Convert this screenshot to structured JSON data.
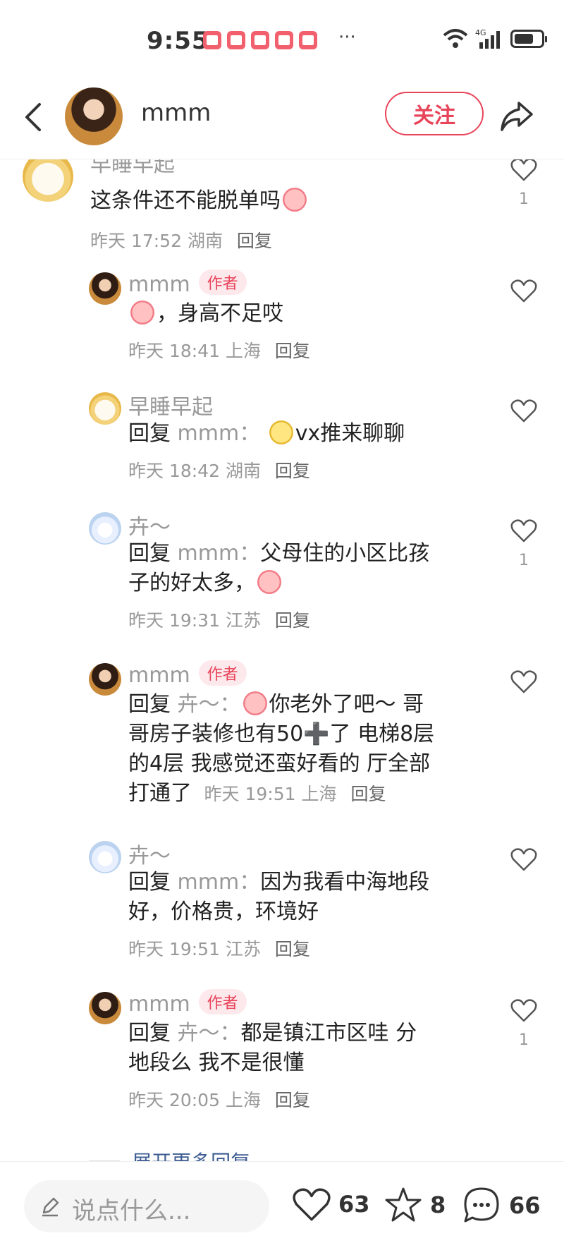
{
  "status_bar": {
    "time": "9:55",
    "network": "4G",
    "more": "···"
  },
  "header": {
    "username": "mmm",
    "follow_label": "关注"
  },
  "comments": [
    {
      "user": "早睡早起",
      "text": "这条件还不能脱单吗",
      "emoji": "crying-face",
      "time": "昨天 17:52",
      "location": "湖南",
      "reply_label": "回复",
      "likes": "1"
    },
    {
      "user": "mmm",
      "badge": "作者",
      "text": "，身高不足哎",
      "emoji": "crying-face",
      "time": "昨天 18:41",
      "location": "上海",
      "reply_label": "回复",
      "likes": ""
    },
    {
      "user": "早睡早起",
      "reply_prefix": "回复",
      "reply_to": "mmm：",
      "text": "vx推来聊聊",
      "emoji": "winking-face",
      "time": "昨天 18:42",
      "location": "湖南",
      "reply_label": "回复",
      "likes": ""
    },
    {
      "user": "卉～",
      "reply_prefix": "回复",
      "reply_to": "mmm：",
      "text_line1": "父母住的小区比孩",
      "text_line2": "子的好太多，",
      "emoji": "crying-face",
      "time": "昨天 19:31",
      "location": "江苏",
      "reply_label": "回复",
      "likes": "1"
    },
    {
      "user": "mmm",
      "badge": "作者",
      "reply_prefix": "回复",
      "reply_to": "卉～：",
      "emoji": "crying-face",
      "text_line1": "你老外了吧～ 哥",
      "text_line2": "哥房子装修也有50➕了 电梯8层",
      "text_line3": "的4层 我感觉还蛮好看的 厅全部",
      "text_line4": "打通了",
      "time": "昨天 19:51",
      "location": "上海",
      "reply_label": "回复",
      "likes": ""
    },
    {
      "user": "卉～",
      "reply_prefix": "回复",
      "reply_to": "mmm：",
      "text_line1": "因为我看中海地段",
      "text_line2": "好，价格贵，环境好",
      "time": "昨天 19:51",
      "location": "江苏",
      "reply_label": "回复",
      "likes": ""
    },
    {
      "user": "mmm",
      "badge": "作者",
      "reply_prefix": "回复",
      "reply_to": "卉～：",
      "text_line1": "都是镇江市区哇 分",
      "text_line2": "地段么 我不是很懂",
      "time": "昨天 20:05",
      "location": "上海",
      "reply_label": "回复",
      "likes": "1"
    }
  ],
  "expand_more": "展开更多回复",
  "bottom_bar": {
    "input_placeholder": "说点什么...",
    "likes": "63",
    "stars": "8",
    "comments": "66"
  }
}
